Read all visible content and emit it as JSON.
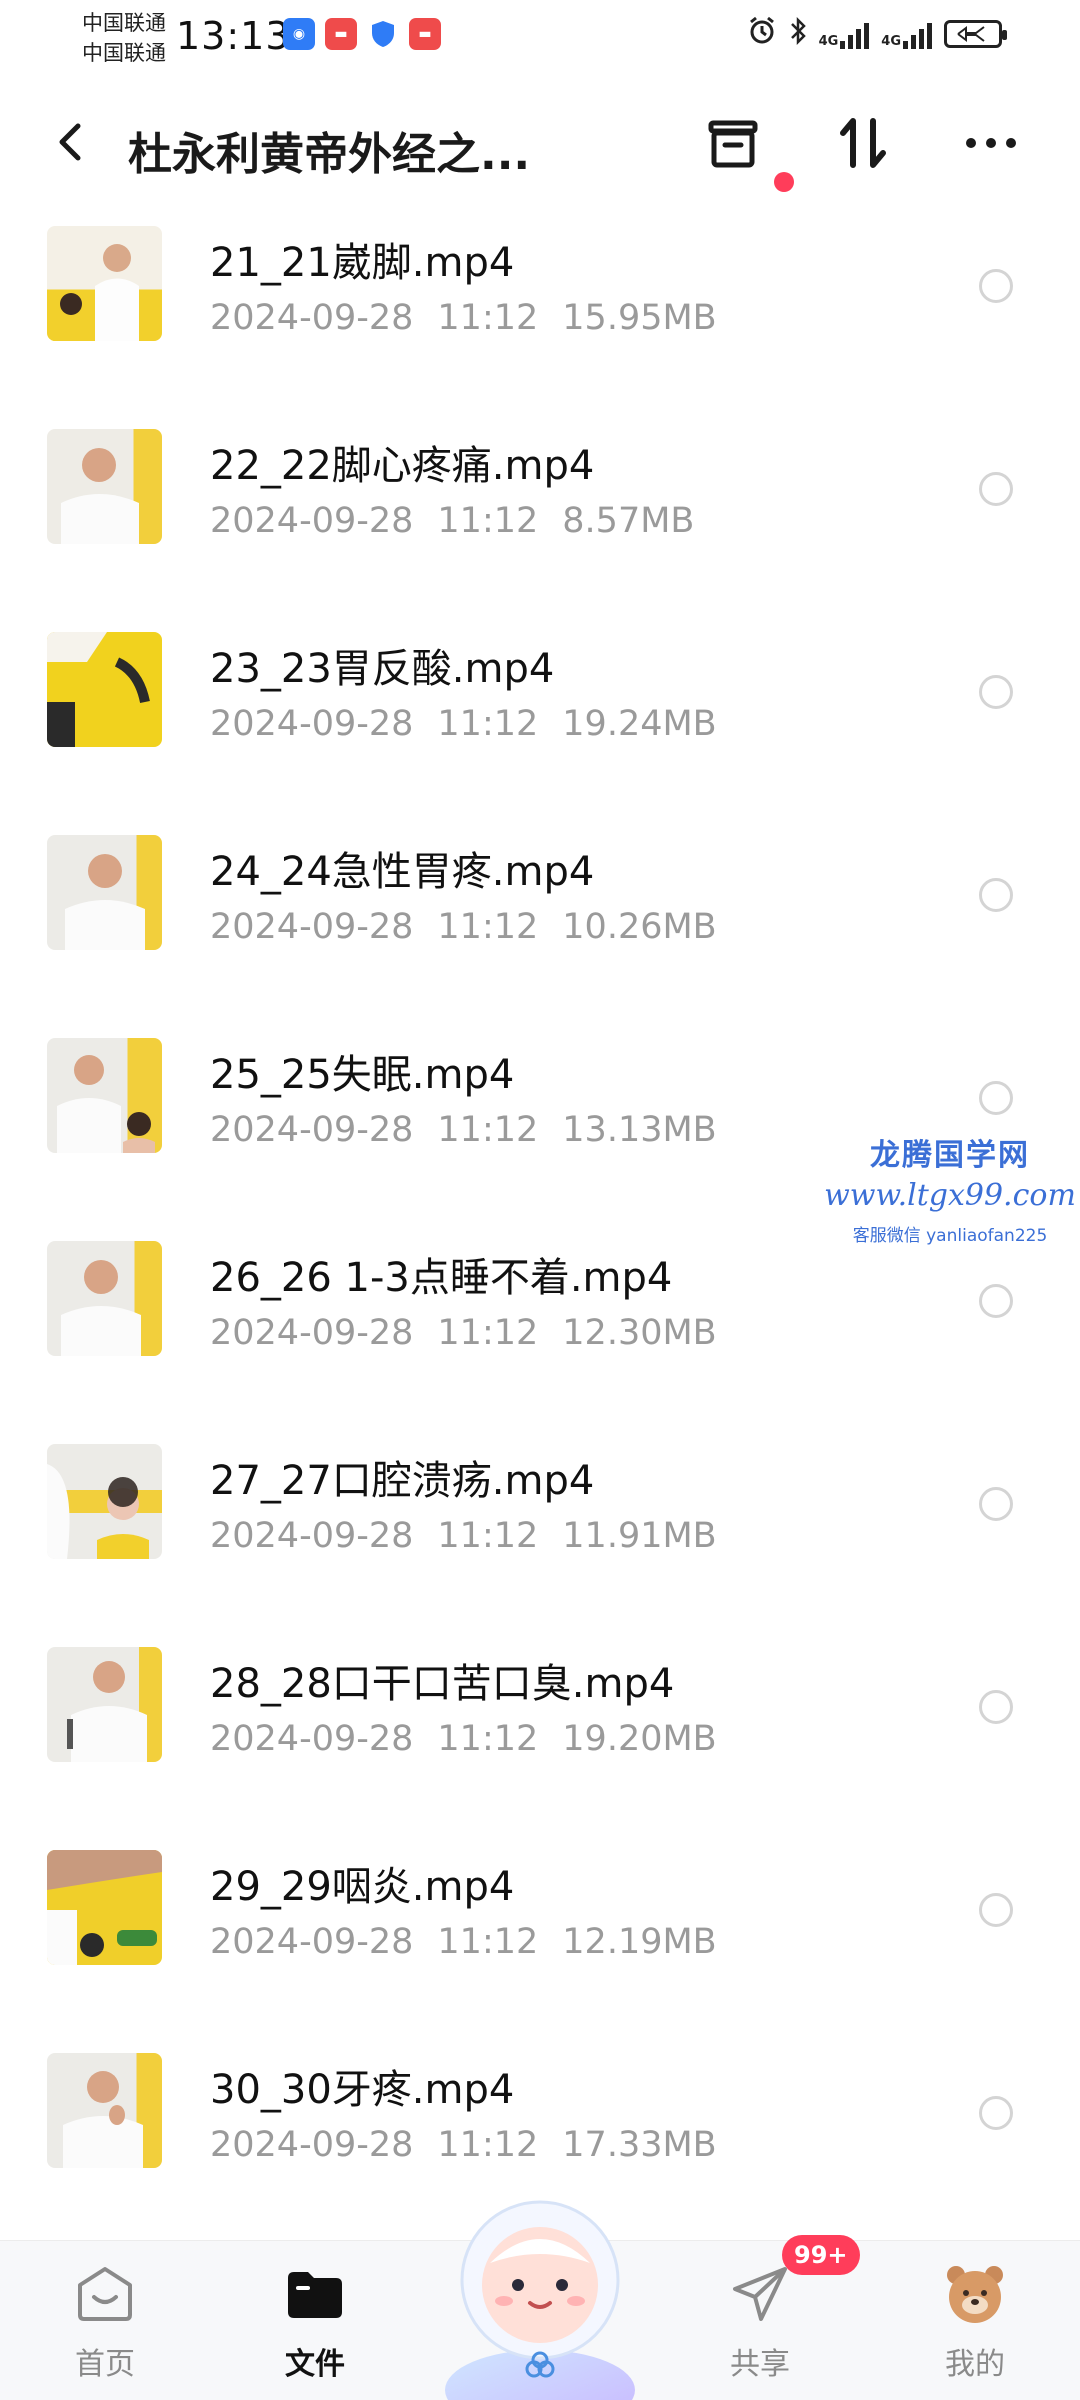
{
  "status_bar": {
    "carrier_1": "中国联通",
    "carrier_2": "中国联通",
    "time": "13:13",
    "net_1": "4G",
    "net_2": "4G",
    "battery_icon": "charging-battery-icon"
  },
  "header": {
    "title": "杜永利黄帝外经之...",
    "icons": [
      "back-icon",
      "archive-icon",
      "sort-icon",
      "more-icon"
    ],
    "notification_dot_color": "#ff3d5a"
  },
  "files": [
    {
      "name": "21_21崴脚.mp4",
      "date": "2024-09-28",
      "time": "11:12",
      "size": "15.95MB"
    },
    {
      "name": "22_22脚心疼痛.mp4",
      "date": "2024-09-28",
      "time": "11:12",
      "size": "8.57MB"
    },
    {
      "name": "23_23胃反酸.mp4",
      "date": "2024-09-28",
      "time": "11:12",
      "size": "19.24MB"
    },
    {
      "name": "24_24急性胃疼.mp4",
      "date": "2024-09-28",
      "time": "11:12",
      "size": "10.26MB"
    },
    {
      "name": "25_25失眠.mp4",
      "date": "2024-09-28",
      "time": "11:12",
      "size": "13.13MB"
    },
    {
      "name": "26_26 1-3点睡不着.mp4",
      "date": "2024-09-28",
      "time": "11:12",
      "size": "12.30MB"
    },
    {
      "name": "27_27口腔溃疡.mp4",
      "date": "2024-09-28",
      "time": "11:12",
      "size": "11.91MB"
    },
    {
      "name": "28_28口干口苦口臭.mp4",
      "date": "2024-09-28",
      "time": "11:12",
      "size": "19.20MB"
    },
    {
      "name": "29_29咽炎.mp4",
      "date": "2024-09-28",
      "time": "11:12",
      "size": "12.19MB"
    },
    {
      "name": "30_30牙疼.mp4",
      "date": "2024-09-28",
      "time": "11:12",
      "size": "17.33MB"
    }
  ],
  "watermark": {
    "line1": "龙腾国学网",
    "line2": "www.ltgx99.com",
    "line3": "客服微信 yanliaofan225"
  },
  "bottom_nav": {
    "tabs": [
      {
        "label": "首页",
        "icon": "home-icon",
        "active": false
      },
      {
        "label": "文件",
        "icon": "folder-icon",
        "active": true
      },
      {
        "label": "共享",
        "icon": "share-plane-icon",
        "active": false
      },
      {
        "label": "我的",
        "icon": "bear-avatar-icon",
        "active": false
      }
    ],
    "share_badge": "99+",
    "center_icon": "mascot-icon"
  },
  "colors": {
    "accent_red": "#ff3d5a",
    "meta_grey": "#9a9a9a",
    "watermark_blue": "#3b6fd6"
  }
}
